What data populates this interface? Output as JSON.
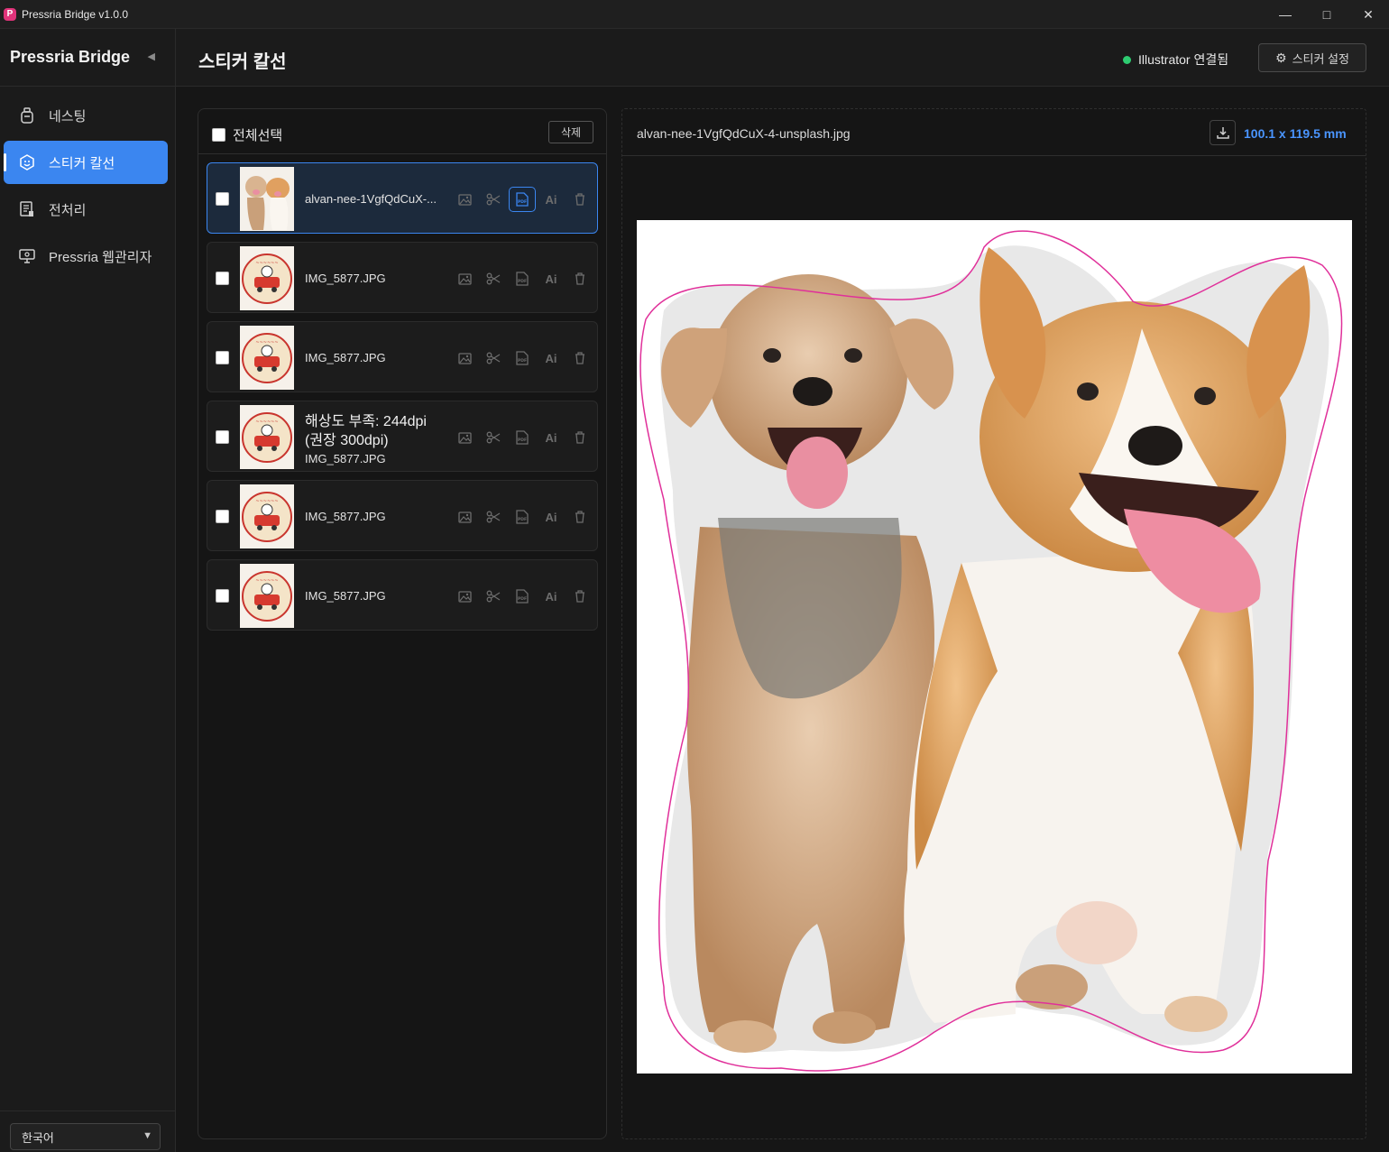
{
  "window": {
    "title": "Pressria Bridge v1.0.0",
    "logo_letter": "P"
  },
  "sidebar": {
    "brand": "Pressria Bridge",
    "items": [
      {
        "label": "네스팅",
        "icon": "nesting-icon"
      },
      {
        "label": "스티커 칼선",
        "icon": "sticker-icon",
        "active": true
      },
      {
        "label": "전처리",
        "icon": "preprocess-icon"
      },
      {
        "label": "Pressria 웹관리자",
        "icon": "monitor-icon"
      }
    ],
    "language": "한국어"
  },
  "header": {
    "title": "스티커 칼선",
    "status_text": "Illustrator 연결됨",
    "status_color": "#2ecc71",
    "settings_label": "스티커 설정"
  },
  "list": {
    "select_all_label": "전체선택",
    "delete_label": "삭제",
    "rows": [
      {
        "name": "alvan-nee-1VgfQdCuX-...",
        "thumb": "dogs",
        "selected": true
      },
      {
        "name": "IMG_5877.JPG",
        "thumb": "sticker"
      },
      {
        "name": "IMG_5877.JPG",
        "thumb": "sticker"
      },
      {
        "name": "IMG_5877.JPG",
        "thumb": "sticker",
        "warning_line1": "해상도 부족: 244dpi",
        "warning_line2": "(권장 300dpi)"
      },
      {
        "name": "IMG_5877.JPG",
        "thumb": "sticker"
      },
      {
        "name": "IMG_5877.JPG",
        "thumb": "sticker"
      }
    ],
    "tool_ai_label": "Ai"
  },
  "preview": {
    "filename": "alvan-nee-1VgfQdCuX-4-unsplash.jpg",
    "dimensions": "100.1 x 119.5 mm",
    "accent": "#4a95ff",
    "cutline_color": "#e0309a"
  }
}
